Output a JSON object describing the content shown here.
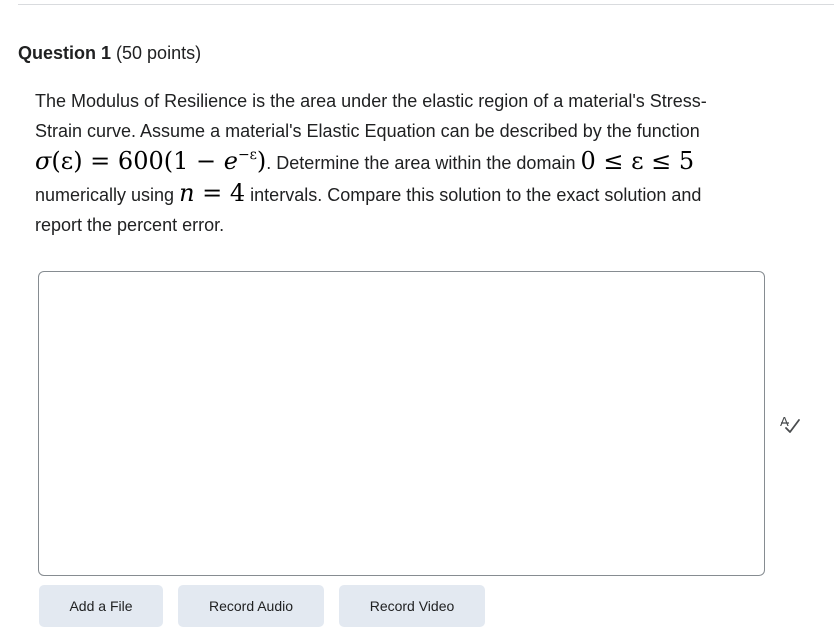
{
  "question": {
    "title": "Question 1",
    "points": "(50 points)"
  },
  "body": {
    "line1": "The Modulus of Resilience is the area under the elastic region of a material's Stress-",
    "line2": "Strain curve. Assume a material's Elastic Equation can be described by the function",
    "eq1_lhs": "σ",
    "eq1_arg": "(ε) = 600(1 − ",
    "eq1_e": "e",
    "eq1_exp": "−ε",
    "eq1_close": ")",
    "line3_text": ". Determine the area within the domain ",
    "eq2": "0 ≤ ε ≤ 5",
    "line4_pre": "numerically using ",
    "eq3_var": "n",
    "eq3_rest": " = 4",
    "line4_post": " intervals. Compare this solution to the exact solution and",
    "line5": "report the percent error."
  },
  "answer": {
    "value": "",
    "placeholder": ""
  },
  "icons": {
    "spellcheck": "spellcheck-icon"
  },
  "buttons": {
    "add_file": "Add a File",
    "record_audio": "Record Audio",
    "record_video": "Record Video"
  }
}
